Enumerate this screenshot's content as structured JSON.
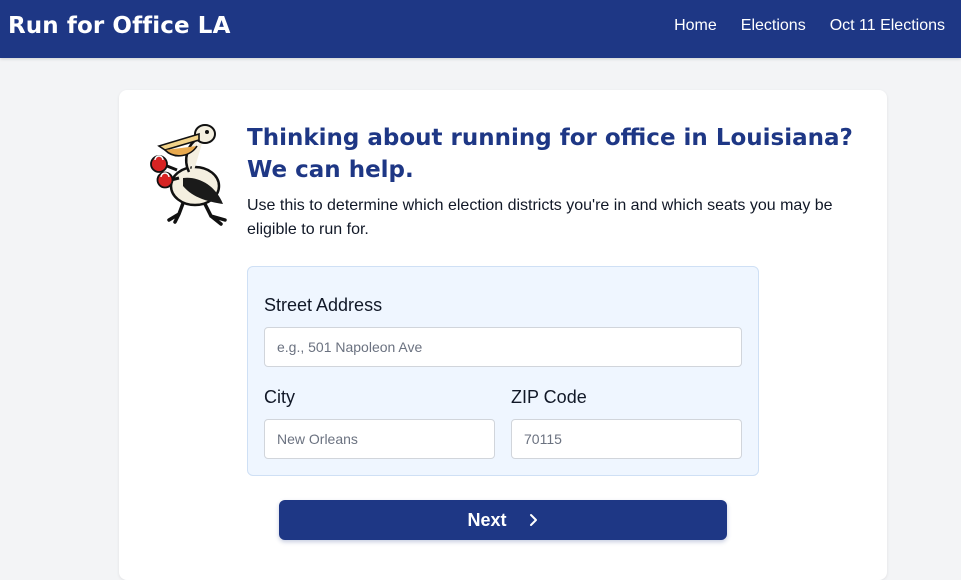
{
  "header": {
    "brand": "Run for Office LA",
    "nav": [
      {
        "label": "Home"
      },
      {
        "label": "Elections"
      },
      {
        "label": "Oct 11 Elections"
      }
    ]
  },
  "hero": {
    "mascot_icon": "pelican-boxing-mascot-icon",
    "headline_line1": "Thinking about running for office in Louisiana?",
    "headline_line2": "We can help.",
    "intro": "Use this to determine which election districts you're in and which seats you may be eligible to run for."
  },
  "form": {
    "street": {
      "label": "Street Address",
      "placeholder": "e.g., 501 Napoleon Ave",
      "value": ""
    },
    "city": {
      "label": "City",
      "placeholder": "New Orleans",
      "value": ""
    },
    "zip": {
      "label": "ZIP Code",
      "placeholder": "70115",
      "value": ""
    },
    "next_label": "Next",
    "next_icon": "chevron-right-icon"
  },
  "colors": {
    "brand_blue": "#1e3785",
    "panel_bg": "#eff6ff",
    "page_bg": "#f3f4f6"
  }
}
